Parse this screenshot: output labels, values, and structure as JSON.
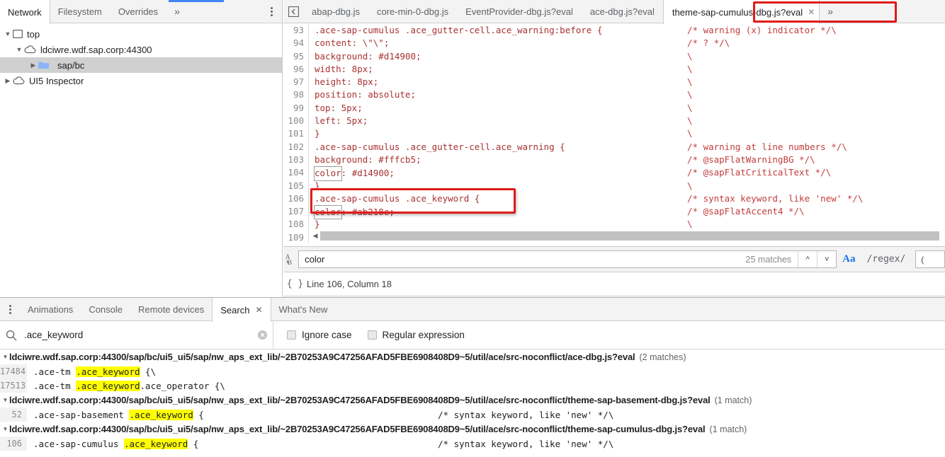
{
  "navigator": {
    "tabs": [
      {
        "label": "Network",
        "active": true
      },
      {
        "label": "Filesystem",
        "active": false
      },
      {
        "label": "Overrides",
        "active": false
      },
      {
        "label": "»",
        "active": false,
        "name": "more-tabs"
      }
    ],
    "menu_icon": "kebab-menu-icon",
    "tree": [
      {
        "label": "top",
        "icon": "frame-icon",
        "indent": 0,
        "expanded": true,
        "selected": false
      },
      {
        "label": "ldciwre.wdf.sap.corp:44300",
        "icon": "cloud-icon",
        "indent": 1,
        "expanded": true,
        "selected": false
      },
      {
        "label": "sap/bc",
        "icon": "folder-icon",
        "indent": 2,
        "expanded": false,
        "selected": true
      },
      {
        "label": "UI5 Inspector",
        "icon": "cloud-icon",
        "indent": 0,
        "expanded": false,
        "selected": false
      }
    ]
  },
  "editor": {
    "panel_toggle_icon": "show-navigator-icon",
    "tabs": [
      {
        "label": "abap-dbg.js",
        "active": false,
        "closeable": false
      },
      {
        "label": "core-min-0-dbg.js",
        "active": false,
        "closeable": false
      },
      {
        "label": "EventProvider-dbg.js?eval",
        "active": false,
        "closeable": false
      },
      {
        "label": "ace-dbg.js?eval",
        "active": false,
        "closeable": false
      },
      {
        "label": "theme-sap-cumulus-dbg.js?eval",
        "active": true,
        "closeable": true
      }
    ],
    "overflow_label": "»",
    "lines": [
      {
        "no": "93",
        "code": ".ace-sap-cumulus .ace_gutter-cell.ace_warning:before {",
        "comment": "/* warning (x) indicator */\\"
      },
      {
        "no": "94",
        "code": "content: \\\"\\\";",
        "comment": "/* ? */\\"
      },
      {
        "no": "95",
        "code": "background: #d14900;",
        "comment": "\\"
      },
      {
        "no": "96",
        "code": "width: 8px;",
        "comment": "\\"
      },
      {
        "no": "97",
        "code": "height: 8px;",
        "comment": "\\"
      },
      {
        "no": "98",
        "code": "position: absolute;",
        "comment": "\\"
      },
      {
        "no": "99",
        "code": "top: 5px;",
        "comment": "\\"
      },
      {
        "no": "100",
        "code": "left: 5px;",
        "comment": "\\"
      },
      {
        "no": "101",
        "code": "}",
        "comment": "\\"
      },
      {
        "no": "102",
        "code": ".ace-sap-cumulus .ace_gutter-cell.ace_warning {",
        "comment": "/* warning at line numbers */\\"
      },
      {
        "no": "103",
        "code": "background: #fffcb5;",
        "comment": "/* @sapFlatWarningBG */\\"
      },
      {
        "no": "104",
        "code": "color: #d14900;",
        "comment": "/* @sapFlatCriticalText */\\",
        "match_token": "color"
      },
      {
        "no": "105",
        "code": "}",
        "comment": "\\"
      },
      {
        "no": "106",
        "code": ".ace-sap-cumulus .ace_keyword {",
        "comment": "/* syntax keyword, like 'new' */\\"
      },
      {
        "no": "107",
        "code": "color: #ab218e;",
        "comment": "/* @sapFlatAccent4 */\\",
        "match_token": "color"
      },
      {
        "no": "108",
        "code": "}",
        "comment": "\\"
      },
      {
        "no": "109",
        "code": "",
        "comment": ""
      }
    ],
    "find": {
      "icon": "case-preserve-icon",
      "query": "color",
      "placeholder": "Find",
      "matches_label": "25 matches",
      "prev_icon": "chevron-up-icon",
      "next_icon": "chevron-down-icon",
      "match_case_label": "Aa",
      "regex_label": "/regex/",
      "extra_value": "("
    },
    "status": {
      "icon": "pretty-print-icon",
      "text": "Line 106, Column 18"
    }
  },
  "drawer": {
    "menu_icon": "kebab-menu-icon",
    "tabs": [
      {
        "label": "Animations",
        "active": false,
        "closeable": false
      },
      {
        "label": "Console",
        "active": false,
        "closeable": false
      },
      {
        "label": "Remote devices",
        "active": false,
        "closeable": false
      },
      {
        "label": "Search",
        "active": true,
        "closeable": true
      },
      {
        "label": "What's New",
        "active": false,
        "closeable": false
      }
    ],
    "search": {
      "icon": "search-icon",
      "query": ".ace_keyword",
      "placeholder": "Search",
      "clear_icon": "clear-circle-icon",
      "ignore_case_label": "Ignore case",
      "ignore_case_checked": false,
      "regular_expression_label": "Regular expression",
      "regular_expression_checked": false
    },
    "results": [
      {
        "url": "ldciwre.wdf.sap.corp:44300/sap/bc/ui5_ui5/sap/nw_aps_ext_lib/~2B70253A9C47256AFAD5FBE6908408D9~5/util/ace/src-noconflict/ace-dbg.js?eval",
        "count": "(2 matches)",
        "expanded": true,
        "rows": [
          {
            "line": "17484",
            "before": " .ace-tm ",
            "match": ".ace_keyword",
            "after": " {\\",
            "comment": ""
          },
          {
            "line": "17513",
            "before": " .ace-tm ",
            "match": ".ace_keyword",
            "after": ".ace_operator {\\",
            "comment": ""
          }
        ]
      },
      {
        "url": "ldciwre.wdf.sap.corp:44300/sap/bc/ui5_ui5/sap/nw_aps_ext_lib/~2B70253A9C47256AFAD5FBE6908408D9~5/util/ace/src-noconflict/theme-sap-basement-dbg.js?eval",
        "count": "(1 match)",
        "expanded": true,
        "rows": [
          {
            "line": "52",
            "before": " .ace-sap-basement ",
            "match": ".ace_keyword",
            "after": " {",
            "comment": "/* syntax keyword, like 'new' */\\"
          }
        ]
      },
      {
        "url": "ldciwre.wdf.sap.corp:44300/sap/bc/ui5_ui5/sap/nw_aps_ext_lib/~2B70253A9C47256AFAD5FBE6908408D9~5/util/ace/src-noconflict/theme-sap-cumulus-dbg.js?eval",
        "count": "(1 match)",
        "expanded": true,
        "rows": [
          {
            "line": "106",
            "before": " .ace-sap-cumulus ",
            "match": ".ace_keyword",
            "after": " {",
            "comment": "/* syntax keyword, like 'new' */\\"
          }
        ]
      }
    ]
  },
  "annotations": {
    "highlight_color": "#e01b1b",
    "tab_highlight": "theme-sap-cumulus-dbg.js?eval",
    "code_highlight_lines": "106-107"
  }
}
